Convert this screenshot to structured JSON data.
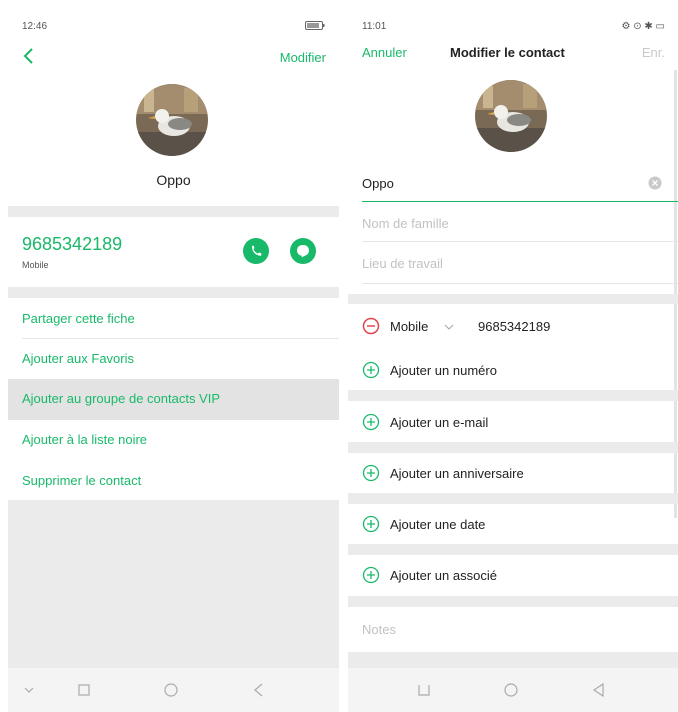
{
  "left": {
    "status": {
      "time": "12:46",
      "battery": "▭"
    },
    "topbar": {
      "action_label": "Modifier"
    },
    "contact": {
      "name": "Oppo",
      "number": "9685342189",
      "number_type": "Mobile"
    },
    "actions": [
      "Partager cette fiche",
      "Ajouter aux Favoris",
      "Ajouter au groupe de contacts VIP",
      "Ajouter à la liste noire",
      "Supprimer le contact"
    ]
  },
  "right": {
    "status": {
      "time": "11:01",
      "right": "⚙ ⊙ ✱ ▭"
    },
    "topbar": {
      "cancel_label": "Annuler",
      "title": "Modifier le contact",
      "save_label": "Enr."
    },
    "fields": {
      "first_name_value": "Oppo",
      "last_name_placeholder": "Nom de famille",
      "workplace_placeholder": "Lieu de travail",
      "phone_type": "Mobile",
      "phone_value": "9685342189"
    },
    "add_items": [
      "Ajouter un numéro",
      "Ajouter un e-mail",
      "Ajouter un anniversaire",
      "Ajouter une date",
      "Ajouter un associé"
    ],
    "notes_placeholder": "Notes"
  },
  "colors": {
    "accent": "#19b96a",
    "remove": "#e2454f",
    "band": "#ebebeb"
  }
}
